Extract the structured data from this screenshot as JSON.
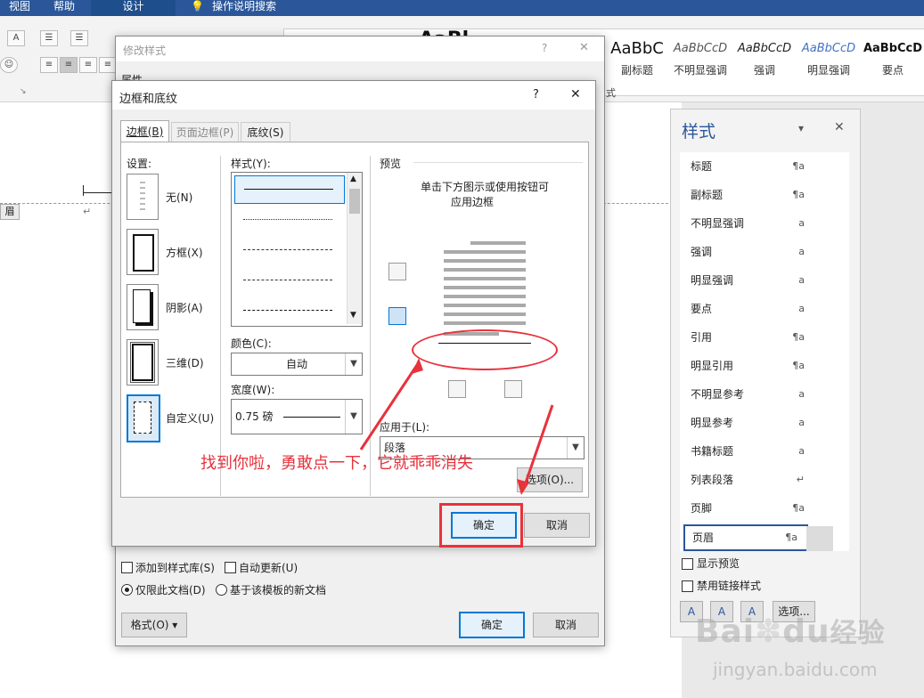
{
  "ribbon": {
    "tabs": [
      "视图",
      "帮助",
      "设计",
      "操作说明搜索"
    ],
    "gallery": [
      {
        "preview": "AaBbC",
        "name": "副标题"
      },
      {
        "preview": "AaBbCcD",
        "name": "不明显强调"
      },
      {
        "preview": "AaBbCcD",
        "name": "强调"
      },
      {
        "preview": "AaBbCcD",
        "name": "明显强调"
      },
      {
        "preview": "AaBbCcD",
        "name": "要点"
      }
    ],
    "group_label_fragment": "式",
    "gallery_partial_preview": "AaBl"
  },
  "doc": {
    "header_tag": "眉",
    "return_mark": "↵"
  },
  "modify_style": {
    "title": "修改样式",
    "help": "?",
    "close": "✕",
    "section_properties": "属性",
    "add_to_gallery": "添加到样式库(S)",
    "auto_update": "自动更新(U)",
    "only_this_doc": "仅限此文档(D)",
    "new_docs_template": "基于该模板的新文档",
    "format_button": "格式(O) ▾",
    "ok": "确定",
    "cancel": "取消"
  },
  "borders": {
    "title": "边框和底纹",
    "help": "?",
    "close": "✕",
    "tabs": [
      "边框(B)",
      "页面边框(P)",
      "底纹(S)"
    ],
    "settings_label": "设置:",
    "settings": [
      "无(N)",
      "方框(X)",
      "阴影(A)",
      "三维(D)",
      "自定义(U)"
    ],
    "style_label": "样式(Y):",
    "color_label": "颜色(C):",
    "color_value": "自动",
    "width_label": "宽度(W):",
    "width_value": "0.75 磅",
    "preview_label": "预览",
    "preview_hint_1": "单击下方图示或使用按钮可",
    "preview_hint_2": "应用边框",
    "apply_label": "应用于(L):",
    "apply_value": "段落",
    "options": "选项(O)...",
    "ok": "确定",
    "cancel": "取消"
  },
  "annotation": {
    "text": "找到你啦，勇敢点一下，它就乖乖消失",
    "color": "#e8323c"
  },
  "styles_pane": {
    "title": "样式",
    "dropdown": "▾",
    "close": "✕",
    "items": [
      {
        "name": "标题",
        "mark": "¶a"
      },
      {
        "name": "副标题",
        "mark": "¶a"
      },
      {
        "name": "不明显强调",
        "mark": "a"
      },
      {
        "name": "强调",
        "mark": "a"
      },
      {
        "name": "明显强调",
        "mark": "a"
      },
      {
        "name": "要点",
        "mark": "a"
      },
      {
        "name": "引用",
        "mark": "¶a"
      },
      {
        "name": "明显引用",
        "mark": "¶a"
      },
      {
        "name": "不明显参考",
        "mark": "a"
      },
      {
        "name": "明显参考",
        "mark": "a"
      },
      {
        "name": "书籍标题",
        "mark": "a"
      },
      {
        "name": "列表段落",
        "mark": "↵"
      },
      {
        "name": "页脚",
        "mark": "¶a"
      },
      {
        "name": "页眉",
        "mark": "¶a"
      }
    ],
    "show_preview": "显示预览",
    "disable_linked": "禁用链接样式",
    "options": "选项..."
  },
  "watermark": {
    "brand": "Bai",
    "brand_tail": "du",
    "cn": "经验",
    "url": "jingyan.baidu.com"
  },
  "colors": {
    "ribbon_blue": "#2b579a",
    "accent": "#0078d7",
    "annotation_red": "#e8323c",
    "pane_title": "#2b579a"
  }
}
